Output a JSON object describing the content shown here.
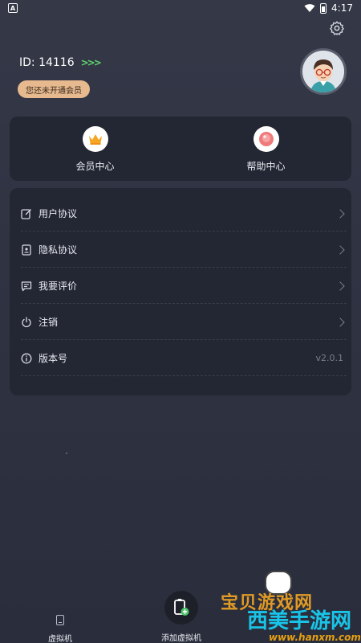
{
  "status_bar": {
    "time": "4:17",
    "left_badge": "A"
  },
  "profile": {
    "id_text": "ID: 14116",
    "arrows": ">>>",
    "vip_badge": "您还未开通会员"
  },
  "quick": [
    {
      "label": "会员中心",
      "icon": "crown-icon"
    },
    {
      "label": "帮助中心",
      "icon": "help-bubble-icon"
    }
  ],
  "menu": [
    {
      "label": "用户协议",
      "icon": "edit-document-icon",
      "right": ""
    },
    {
      "label": "隐私协议",
      "icon": "id-card-icon",
      "right": ""
    },
    {
      "label": "我要评价",
      "icon": "comment-icon",
      "right": ""
    },
    {
      "label": "注销",
      "icon": "power-icon",
      "right": ""
    },
    {
      "label": "版本号",
      "icon": "info-icon",
      "right": "v2.0.1"
    }
  ],
  "bottom_nav": {
    "vm_label": "虚拟机",
    "add_label": "添加虚拟机"
  },
  "watermark": {
    "top": "宝贝游戏网",
    "middle": "西美手游网",
    "url": "www.hanxm.com"
  },
  "colors": {
    "background": "#2f3342",
    "card": "#232633",
    "vip_badge": "#e6b98f",
    "accent_green": "#5fd36b"
  }
}
